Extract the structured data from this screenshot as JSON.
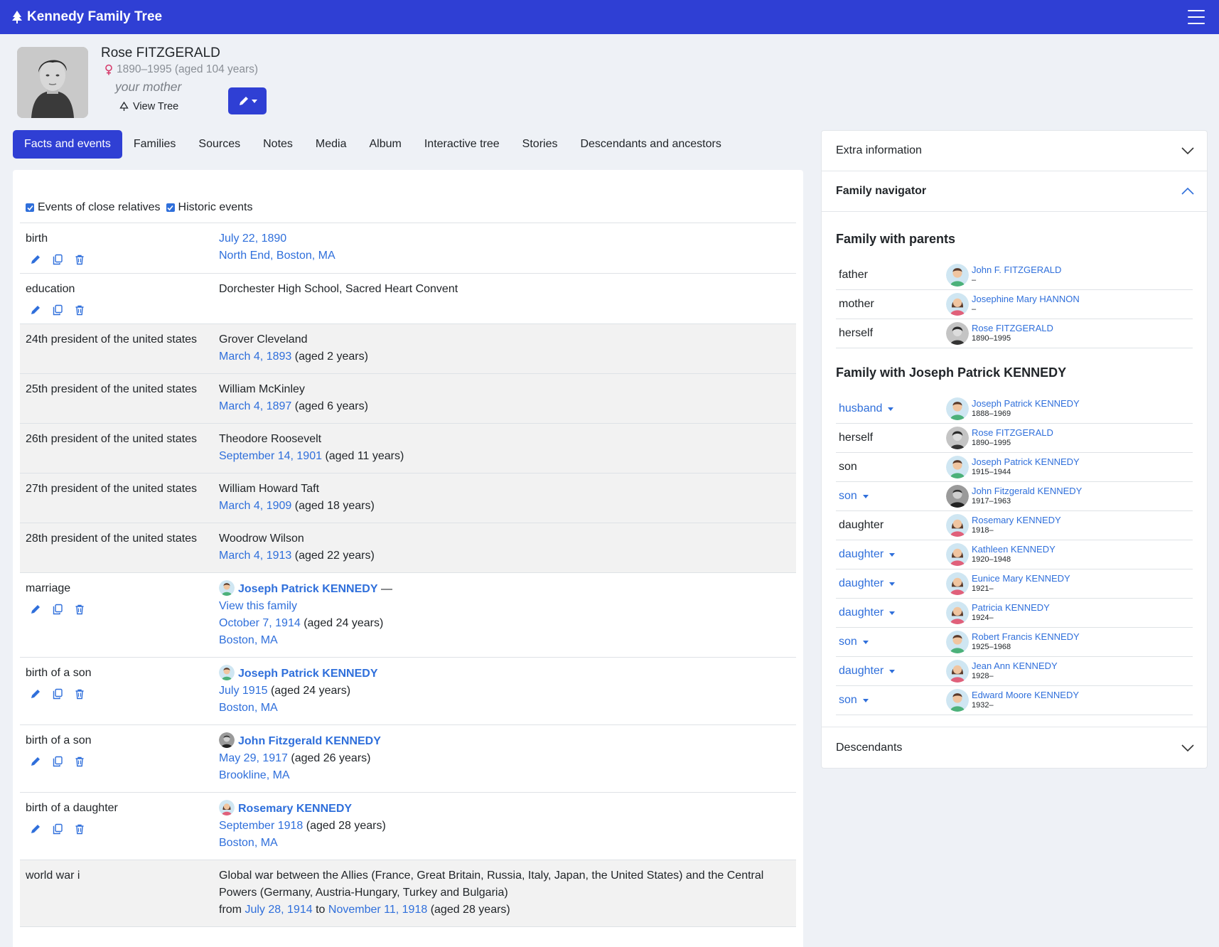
{
  "app": {
    "title": "Kennedy Family Tree"
  },
  "person": {
    "name": "Rose FITZGERALD",
    "dates": "1890–1995 (aged 104 years)",
    "relation": "your mother",
    "view_tree_label": "View Tree"
  },
  "tabs": [
    {
      "label": "Facts and events",
      "active": true
    },
    {
      "label": "Families"
    },
    {
      "label": "Sources"
    },
    {
      "label": "Notes"
    },
    {
      "label": "Media"
    },
    {
      "label": "Album"
    },
    {
      "label": "Interactive tree"
    },
    {
      "label": "Stories"
    },
    {
      "label": "Descendants and ancestors"
    }
  ],
  "filters": {
    "close_relatives": "Events of close relatives",
    "historic": "Historic events"
  },
  "events": {
    "birth": {
      "type": "birth",
      "date": "July 22, 1890",
      "place": "North End, Boston, MA"
    },
    "education": {
      "type": "education",
      "desc": "Dorchester High School, Sacred Heart Convent"
    },
    "p24": {
      "type": "24th president of the united states",
      "name": "Grover Cleveland",
      "date": "March 4, 1893",
      "age": "(aged 2 years)"
    },
    "p25": {
      "type": "25th president of the united states",
      "name": "William McKinley",
      "date": "March 4, 1897",
      "age": "(aged 6 years)"
    },
    "p26": {
      "type": "26th president of the united states",
      "name": "Theodore Roosevelt",
      "date": "September 14, 1901",
      "age": "(aged 11 years)"
    },
    "p27": {
      "type": "27th president of the united states",
      "name": "William Howard Taft",
      "date": "March 4, 1909",
      "age": "(aged 18 years)"
    },
    "p28": {
      "type": "28th president of the united states",
      "name": "Woodrow Wilson",
      "date": "March 4, 1913",
      "age": "(aged 22 years)"
    },
    "marriage": {
      "type": "marriage",
      "spouse": "Joseph Patrick KENNEDY",
      "dash": "—",
      "family_link": "View this family",
      "date": "October 7, 1914",
      "age": "(aged 24 years)",
      "place": "Boston, MA"
    },
    "son1": {
      "type": "birth of a son",
      "name": "Joseph Patrick KENNEDY",
      "date": "July 1915",
      "age": "(aged 24 years)",
      "place": "Boston, MA"
    },
    "son2": {
      "type": "birth of a son",
      "name": "John Fitzgerald KENNEDY",
      "date": "May 29, 1917",
      "age": "(aged 26 years)",
      "place": "Brookline, MA"
    },
    "dau1": {
      "type": "birth of a daughter",
      "name": "Rosemary KENNEDY",
      "date": "September 1918",
      "age": "(aged 28 years)",
      "place": "Boston, MA"
    },
    "ww1": {
      "type": "world war i",
      "desc": "Global war between the Allies (France, Great Britain, Russia, Italy, Japan, the United States) and the Central Powers (Germany, Austria-Hungary, Turkey and Bulgaria)",
      "from": "from",
      "start": "July 28, 1914",
      "to": "to",
      "end": "November 11, 1918",
      "age": "(aged 28 years)"
    }
  },
  "sidebar": {
    "extra_info": "Extra information",
    "family_navigator": "Family navigator",
    "descendants": "Descendants",
    "parents_heading": "Family with parents",
    "spouse_heading": "Family with Joseph Patrick KENNEDY",
    "parents": [
      {
        "role": "father",
        "name": "John F. FITZGERALD",
        "dates": "–",
        "sex": "m"
      },
      {
        "role": "mother",
        "name": "Josephine Mary HANNON",
        "dates": "–",
        "sex": "f"
      },
      {
        "role": "herself",
        "name": "Rose FITZGERALD",
        "dates": "1890–1995",
        "sex": "photo"
      }
    ],
    "family": [
      {
        "role": "husband",
        "name": "Joseph Patrick KENNEDY",
        "dates": "1888–1969",
        "sex": "m",
        "menu": true
      },
      {
        "role": "herself",
        "name": "Rose FITZGERALD",
        "dates": "1890–1995",
        "sex": "photo"
      },
      {
        "role": "son",
        "name": "Joseph Patrick KENNEDY",
        "dates": "1915–1944",
        "sex": "m"
      },
      {
        "role": "son",
        "name": "John Fitzgerald KENNEDY",
        "dates": "1917–1963",
        "sex": "photo-m",
        "menu": true
      },
      {
        "role": "daughter",
        "name": "Rosemary KENNEDY",
        "dates": "1918–",
        "sex": "f"
      },
      {
        "role": "daughter",
        "name": "Kathleen KENNEDY",
        "dates": "1920–1948",
        "sex": "f",
        "menu": true
      },
      {
        "role": "daughter",
        "name": "Eunice Mary KENNEDY",
        "dates": "1921–",
        "sex": "f",
        "menu": true
      },
      {
        "role": "daughter",
        "name": "Patricia KENNEDY",
        "dates": "1924–",
        "sex": "f",
        "menu": true
      },
      {
        "role": "son",
        "name": "Robert Francis KENNEDY",
        "dates": "1925–1968",
        "sex": "m",
        "menu": true
      },
      {
        "role": "daughter",
        "name": "Jean Ann KENNEDY",
        "dates": "1928–",
        "sex": "f",
        "menu": true
      },
      {
        "role": "son",
        "name": "Edward Moore KENNEDY",
        "dates": "1932–",
        "sex": "m",
        "menu": true
      }
    ]
  }
}
